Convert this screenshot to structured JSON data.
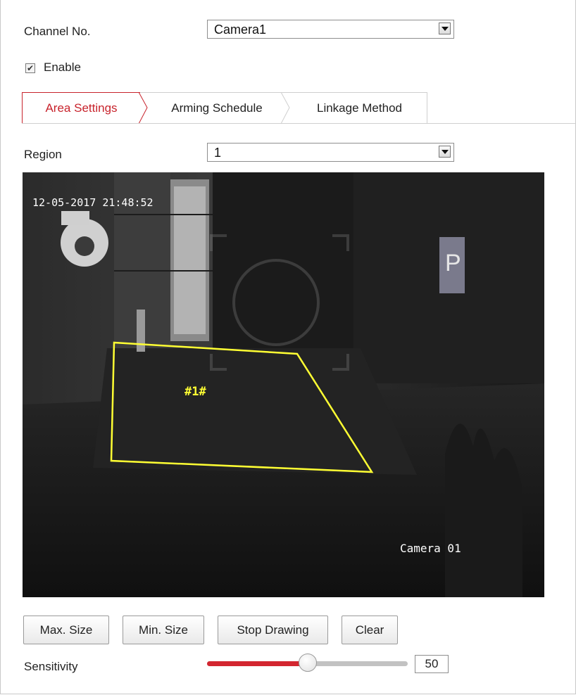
{
  "channel": {
    "label": "Channel No.",
    "selected": "Camera1"
  },
  "enable": {
    "label": "Enable",
    "checked": true
  },
  "tabs": [
    {
      "label": "Area Settings",
      "active": true
    },
    {
      "label": "Arming Schedule",
      "active": false
    },
    {
      "label": "Linkage Method",
      "active": false
    }
  ],
  "region": {
    "label": "Region",
    "selected": "1"
  },
  "video": {
    "timestamp": "12-05-2017 21:48:52",
    "camera_name": "Camera 01",
    "zone_label": "#1#",
    "zone_color": "#ffff33"
  },
  "buttons": {
    "max_size": "Max. Size",
    "min_size": "Min. Size",
    "stop_drawing": "Stop Drawing",
    "clear": "Clear"
  },
  "sensitivity": {
    "label": "Sensitivity",
    "value": "50",
    "fraction": 0.5
  },
  "colors": {
    "accent": "#c8232c",
    "slider_fill": "#d32630"
  }
}
